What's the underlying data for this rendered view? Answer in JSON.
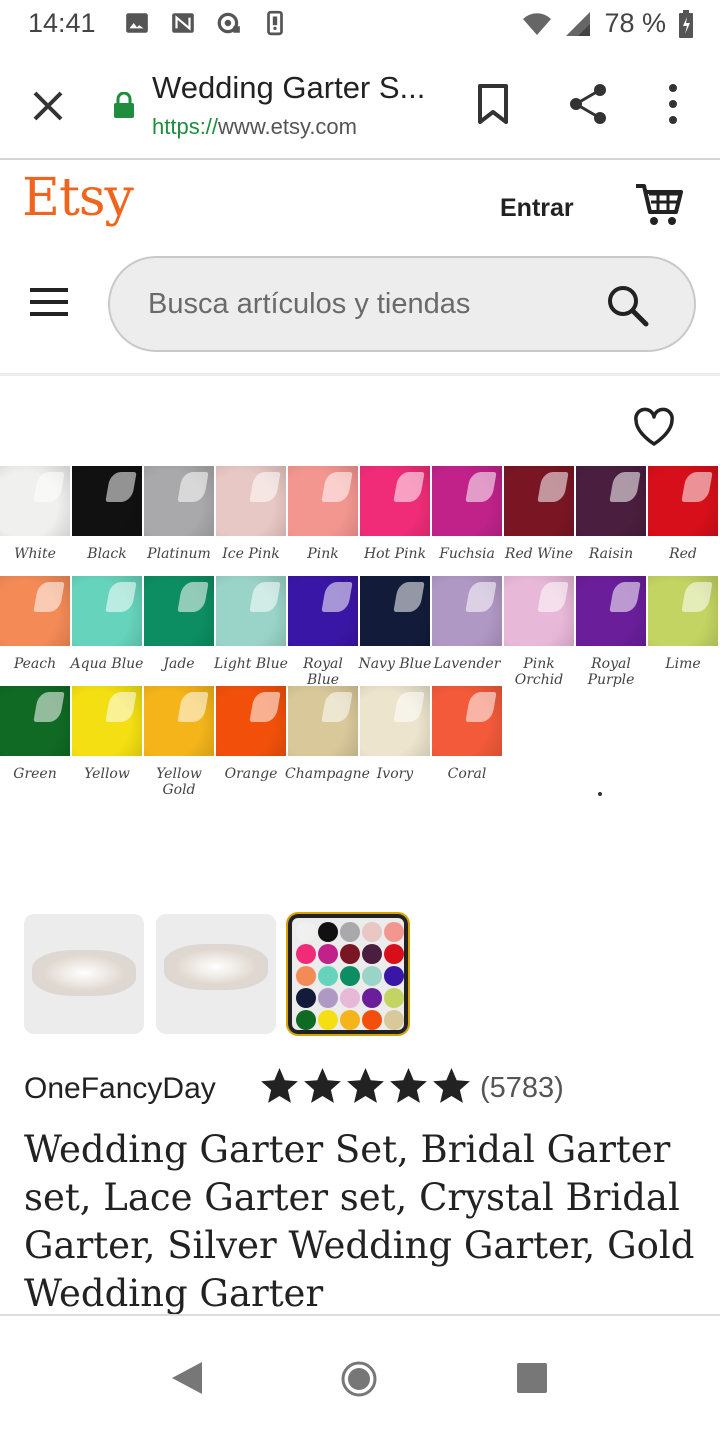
{
  "status_bar": {
    "time": "14:41",
    "battery": "78 %",
    "icons": [
      "image-icon",
      "nfc-icon",
      "hotspot-icon",
      "vibrate-icon",
      "wifi-icon",
      "signal-icon",
      "battery-icon"
    ]
  },
  "browser": {
    "page_title": "Wedding Garter S...",
    "url_scheme": "https://",
    "url_host": "www.etsy.com",
    "accent_color": "#1e8e3e"
  },
  "header": {
    "logo": "Etsy",
    "logo_color": "#f1641e",
    "signin_label": "Entrar",
    "search_placeholder": "Busca artículos y tiendas"
  },
  "swatches": [
    {
      "label": "White",
      "color": "#f0f0ee"
    },
    {
      "label": "Black",
      "color": "#111111"
    },
    {
      "label": "Platinum",
      "color": "#a9a9ab"
    },
    {
      "label": "Ice Pink",
      "color": "#e8c8c4"
    },
    {
      "label": "Pink",
      "color": "#f49690"
    },
    {
      "label": "Hot Pink",
      "color": "#f02c78"
    },
    {
      "label": "Fuchsia",
      "color": "#c0228a"
    },
    {
      "label": "Red Wine",
      "color": "#7a1624"
    },
    {
      "label": "Raisin",
      "color": "#4a1e3e"
    },
    {
      "label": "Red",
      "color": "#d60f1a"
    },
    {
      "label": "Peach",
      "color": "#f48a56"
    },
    {
      "label": "Aqua Blue",
      "color": "#66d4bc"
    },
    {
      "label": "Jade",
      "color": "#0c8e62"
    },
    {
      "label": "Light Blue",
      "color": "#9ad4c8"
    },
    {
      "label": "Royal Blue",
      "color": "#3a16a6"
    },
    {
      "label": "Navy Blue",
      "color": "#121c3a"
    },
    {
      "label": "Lavender",
      "color": "#b098c4"
    },
    {
      "label": "Pink Orchid",
      "color": "#e8b8d8"
    },
    {
      "label": "Royal Purple",
      "color": "#6a1e9a"
    },
    {
      "label": "Lime",
      "color": "#c4d462"
    },
    {
      "label": "Green",
      "color": "#106a24"
    },
    {
      "label": "Yellow",
      "color": "#f4e012"
    },
    {
      "label": "Yellow Gold",
      "color": "#f4b41a"
    },
    {
      "label": "Orange",
      "color": "#f2500a"
    },
    {
      "label": "Champagne",
      "color": "#d8c89a"
    },
    {
      "label": "Ivory",
      "color": "#ece4cc"
    },
    {
      "label": "Coral",
      "color": "#f25a3a"
    }
  ],
  "product": {
    "shop_name": "OneFancyDay",
    "rating": 5,
    "rating_max": 5,
    "review_count": "(5783)",
    "title": "Wedding Garter Set, Bridal Garter set, Lace Garter set, Crystal Bridal Garter, Silver Wedding Garter, Gold Wedding Garter"
  },
  "thumbnails": [
    {
      "name": "thumbnail-garter-1",
      "selected": false
    },
    {
      "name": "thumbnail-garter-2",
      "selected": false
    },
    {
      "name": "thumbnail-color-chart",
      "selected": true
    }
  ]
}
